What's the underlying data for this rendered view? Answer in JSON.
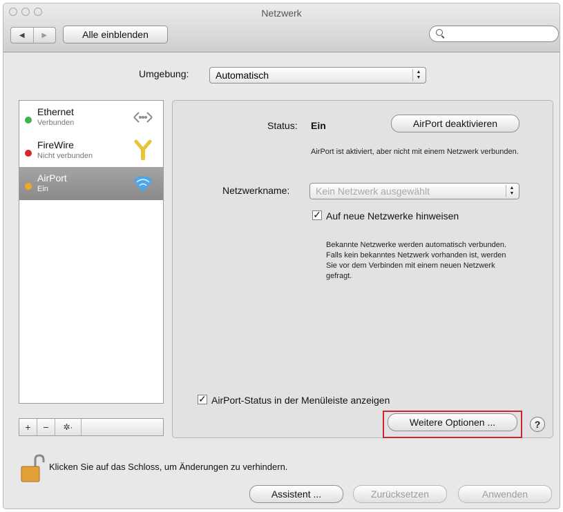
{
  "window": {
    "title": "Netzwerk"
  },
  "toolbar": {
    "back_icon": "◀",
    "forward_icon": "▶",
    "show_all_label": "Alle einblenden",
    "search_placeholder": ""
  },
  "location": {
    "label": "Umgebung:",
    "value": "Automatisch"
  },
  "services": [
    {
      "name": "Ethernet",
      "status": "Verbunden",
      "status_color": "#3bb54a",
      "icon": "ethernet-icon"
    },
    {
      "name": "FireWire",
      "status": "Nicht verbunden",
      "status_color": "#d8262c",
      "icon": "firewire-icon"
    },
    {
      "name": "AirPort",
      "status": "Ein",
      "status_color": "#f0a81e",
      "icon": "wifi-icon"
    }
  ],
  "sidebar_tools": {
    "add": "+",
    "remove": "−",
    "gear": "✲·"
  },
  "detail": {
    "status_label": "Status:",
    "status_value": "Ein",
    "toggle_button": "AirPort deaktivieren",
    "status_info": "AirPort ist aktiviert, aber nicht mit einem Netzwerk verbunden.",
    "network_label": "Netzwerkname:",
    "network_placeholder": "Kein Netzwerk ausgewählt",
    "ask_new_label": "Auf neue Netzwerke hinweisen",
    "ask_new_checked": true,
    "ask_new_info": "Bekannte Netzwerke werden automatisch verbunden. Falls kein bekanntes Netzwerk vorhanden ist, werden Sie vor dem Verbinden mit einem neuen Netzwerk gefragt.",
    "menubar_label": "AirPort-Status in der Menüleiste anzeigen",
    "menubar_checked": true,
    "advanced_button": "Weitere Optionen ...",
    "help_label": "?"
  },
  "footer": {
    "lock_text": "Klicken Sie auf das Schloss, um Änderungen zu verhindern.",
    "assistant_button": "Assistent ...",
    "revert_button": "Zurücksetzen",
    "apply_button": "Anwenden"
  },
  "colors": {
    "highlight": "#d0262b",
    "selected_row": "#969696"
  }
}
